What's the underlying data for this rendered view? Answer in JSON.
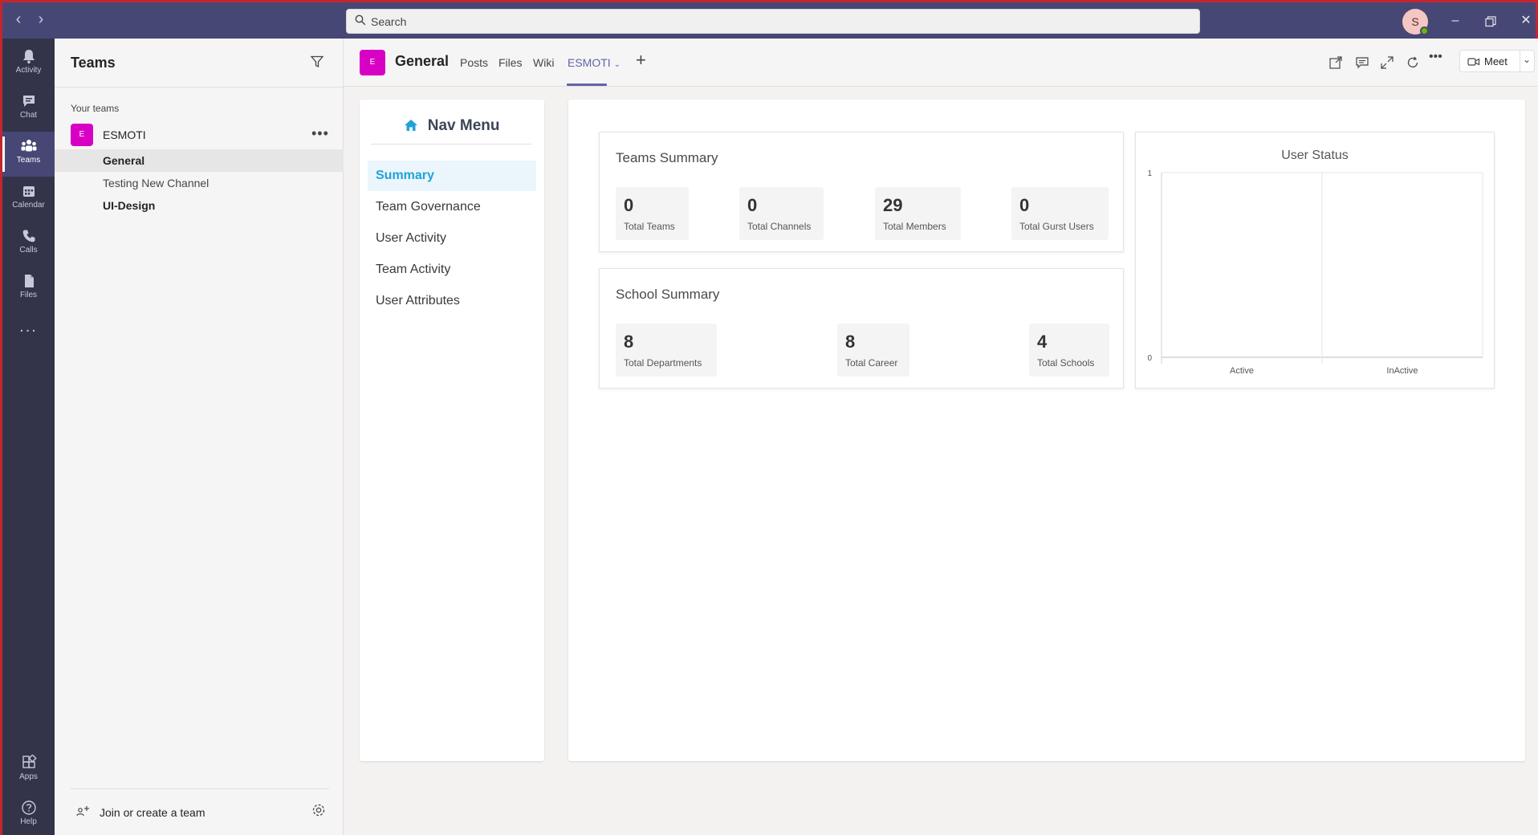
{
  "titlebar": {
    "search_placeholder": "Search",
    "avatar_initial": "S"
  },
  "rail": {
    "items": [
      {
        "label": "Activity",
        "icon": "bell-icon"
      },
      {
        "label": "Chat",
        "icon": "chat-icon"
      },
      {
        "label": "Teams",
        "icon": "teams-icon"
      },
      {
        "label": "Calendar",
        "icon": "calendar-icon"
      },
      {
        "label": "Calls",
        "icon": "phone-icon"
      },
      {
        "label": "Files",
        "icon": "file-icon"
      }
    ],
    "more": "...",
    "bottom": [
      {
        "label": "Apps",
        "icon": "apps-icon"
      },
      {
        "label": "Help",
        "icon": "help-icon"
      }
    ]
  },
  "teams_panel": {
    "title": "Teams",
    "section_label": "Your teams",
    "team": {
      "tile": "E",
      "name": "ESMOTI"
    },
    "channels": [
      {
        "name": "General"
      },
      {
        "name": "Testing New Channel"
      },
      {
        "name": "UI-Design"
      }
    ],
    "join_label": "Join or create a team"
  },
  "channel_header": {
    "tile": "E",
    "name": "General",
    "tabs": [
      "Posts",
      "Files",
      "Wiki",
      "ESMOTI"
    ],
    "active_tab": "ESMOTI",
    "meet_label": "Meet"
  },
  "nav_menu": {
    "title": "Nav Menu",
    "items": [
      "Summary",
      "Team Governance",
      "User Activity",
      "Team Activity",
      "User Attributes"
    ],
    "active": "Summary"
  },
  "teams_summary": {
    "title": "Teams Summary",
    "stats": [
      {
        "value": "0",
        "label": "Total Teams"
      },
      {
        "value": "0",
        "label": "Total Channels"
      },
      {
        "value": "29",
        "label": "Total Members"
      },
      {
        "value": "0",
        "label": "Total Gurst Users"
      }
    ]
  },
  "school_summary": {
    "title": "School Summary",
    "stats": [
      {
        "value": "8",
        "label": "Total Departments"
      },
      {
        "value": "8",
        "label": "Total Career"
      },
      {
        "value": "4",
        "label": "Total Schools"
      }
    ]
  },
  "chart_data": {
    "type": "bar",
    "title": "User Status",
    "categories": [
      "Active",
      "InActive"
    ],
    "values": [
      0,
      0
    ],
    "ylim": [
      0,
      1
    ],
    "yticks": [
      "0",
      "1"
    ],
    "xlabel": "",
    "ylabel": ""
  },
  "colors": {
    "titlebar": "#464775",
    "rail": "#33344a",
    "accent": "#6264a7",
    "team_tile": "#d800c4",
    "nav_active": "#1fa2d8"
  }
}
